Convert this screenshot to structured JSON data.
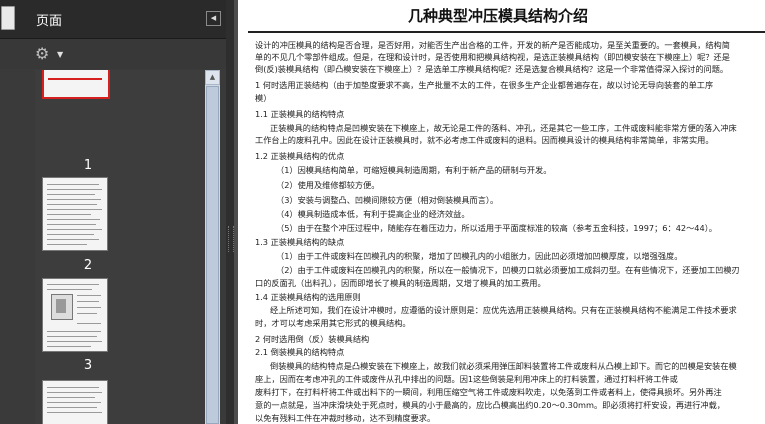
{
  "panel": {
    "title": "页面",
    "collapse_glyph": "◀",
    "options_icon": "gear-icon",
    "thumbnails": [
      {
        "page_label": "1"
      },
      {
        "page_label": "2"
      },
      {
        "page_label": "3"
      }
    ]
  },
  "document": {
    "title": "几种典型冲压模具结构介绍",
    "lines": [
      "设计的冲压模具的结构是否合理，是否好用，对能否生产出合格的工件，开发的新产是否能成功，是至关重要的。一套模具，结构简",
      "单的不见几个零部件组成。但是，在理和设计时，是否使用和把模具结构视，是选正装模具结构（即凹模安装在下模座上）呢？还是",
      "倒(反)装模具结构（即凸模安装在下模座上）？是选单工序模具结构呢？还是选复合模具结构？这是一个非常值得深入探讨的问题。",
      "1 何时选用正装结构（由于加垫度要求不高，生产批量不太的工件，在很多生产企业都普遍存在，故以讨论无导向装套的单工序",
      "模）",
      "1.1 正装模具的结构特点",
      "正装模具的结构特点是凹模安装在下模座上，故无论是工件的落料、冲孔，还是其它一些工序，工件或废料能非常方便的落入冲床",
      "工作台上的废料孔中。因此在设计正装模具时，就不必考虑工件或废料的退料。因而模具设计的模具结构非常简单，非常实用。",
      "1.2 正装模具结构的优点",
      "（1）因模具结构简单，可缩短模具制造周期，有利于新产品的研制与开发。",
      "（2）使用及维修都较方便。",
      "（3）安装与调整凸、凹模间隙较方便（相对倒装模具而言）。",
      "（4）模具制造成本低，有利于提高企业的经济效益。",
      "（5）由于在整个冲压过程中，随能存在着压边力，所以适用于平面度标准的较高（参考五金科技，1997；6：42～44）。",
      "1.3 正装模具结构的缺点",
      "（1）由于工件或废料在凹模孔内的积聚，增加了凹模孔内的小组胀力，因此凹必须增加凹模厚度，以增强强度。",
      "（2）由于工件或废料在凹模孔内的积聚，所以在一般情况下，凹模刃口就必须要加工成斜刃型。在有些情况下，还要加工凹模刃",
      "口的反面孔（出料孔），因而即增长了模具的制造周期，又增了模具的加工费用。",
      "1.4 正装模具结构的选用原则",
      "经上所述可知，我们在设计冲模时，应遵循的设计原则是：应优先选用正装模具结构。只有在正装模具结构不能满足工件技术要求",
      "时，才可以考虑采用其它形式的模具结构。",
      "2 何时选用倒（反）装模具结构",
      "2.1 倒装模具的结构特点",
      "倒装模具的结构特点是凸模安装在下模座上，故我们就必须采用弹压卸料装置将工件或废料从凸模上卸下。而它的凹模是安装在模",
      "座上，因而在考虑冲孔的工件或废件从孔中排出的问题。因1这些倒装是利用冲床上的打料装置，通过打料杆将工件或",
      "废料打下，在打料杆将工件或出料下的一瞬间，利用压缩空气将工件或废料吹走，以免落到工件或者料上，使得具损坏。另外再注",
      "意的一点就是，当冲床滑块处于死点时，模具的小于最高的，应比凸模高出约0.20～0.30mm。即必须将打杆安设，再进行冲载，",
      "以免有残料工件在冲裁时移动，达不到精度要求。"
    ]
  }
}
